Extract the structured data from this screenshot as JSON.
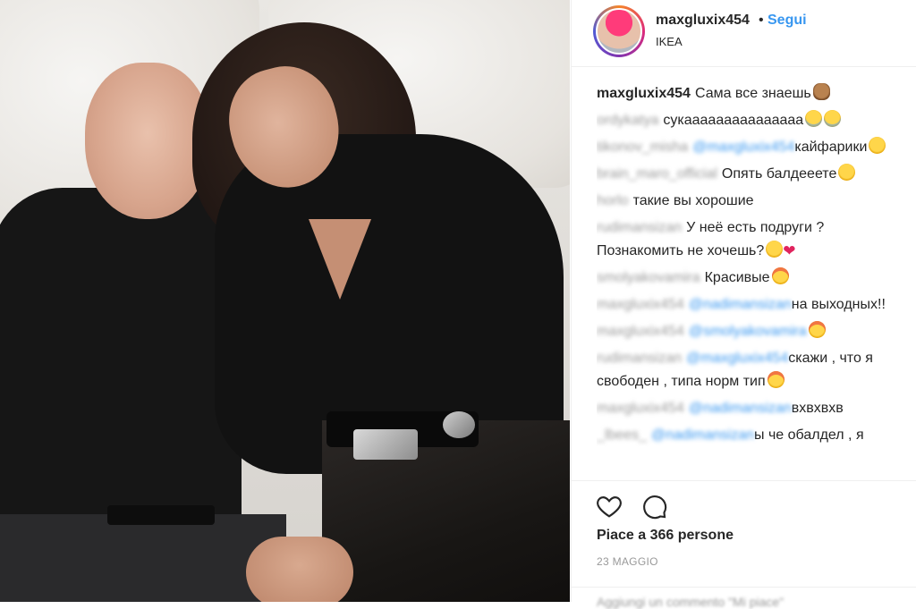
{
  "post": {
    "username": "maxgluxix454",
    "separator": "•",
    "follow_label": "Segui",
    "location": "IKEA"
  },
  "comments": [
    {
      "user": "maxgluxix454",
      "user_blurred": false,
      "mention": "",
      "text": "Сама все знаешь",
      "emoji": "monkey"
    },
    {
      "user": "ordykatya",
      "user_blurred": true,
      "mention": "",
      "text": "сукааааааааааааааа",
      "emoji": "cry-cry"
    },
    {
      "user": "tikonov_misha",
      "user_blurred": true,
      "mention": "@maxgluxix454",
      "text": "кайфарики",
      "emoji": "grin"
    },
    {
      "user": "brain_maro_official",
      "user_blurred": true,
      "mention": "",
      "text": "Опять балдееете",
      "emoji": "grin"
    },
    {
      "user": "horlo",
      "user_blurred": true,
      "mention": "",
      "text": "такие вы хорошие",
      "emoji": ""
    },
    {
      "user": "rudimansizan",
      "user_blurred": true,
      "mention": "",
      "text": "У неё есть подруги ? Познакомить не хочешь?",
      "emoji": "grin-heart"
    },
    {
      "user": "smolyakovamira",
      "user_blurred": true,
      "mention": "",
      "text": "Красивые",
      "emoji": "heart-eyes"
    },
    {
      "user": "maxgluxix454",
      "user_blurred": true,
      "mention": "@nadimansizan",
      "text": "на выходных!!",
      "emoji": ""
    },
    {
      "user": "maxgluxix454",
      "user_blurred": true,
      "mention": "@smolyakovamira",
      "text": "",
      "emoji": "heart-eyes"
    },
    {
      "user": "rudimansizan",
      "user_blurred": true,
      "mention": "@maxgluxix454",
      "text": "скажи , что я свободен , типа норм тип",
      "emoji": "heart-eyes"
    },
    {
      "user": "maxgluxix454",
      "user_blurred": true,
      "mention": "@nadimansizan",
      "text": "вхвхвхв",
      "emoji": ""
    },
    {
      "user": "_lbees_",
      "user_blurred": true,
      "mention": "@nadimansizan",
      "text": "ы че обалдел , я",
      "emoji": ""
    }
  ],
  "actions": {
    "likes_text": "Piace a 366 persone",
    "date": "23 MAGGIO",
    "add_comment_placeholder": "Aggiungi un commento \"Mi piace\""
  },
  "colors": {
    "accent": "#3897f0",
    "text": "#262626",
    "muted": "#999999",
    "heart": "#e0245e"
  }
}
